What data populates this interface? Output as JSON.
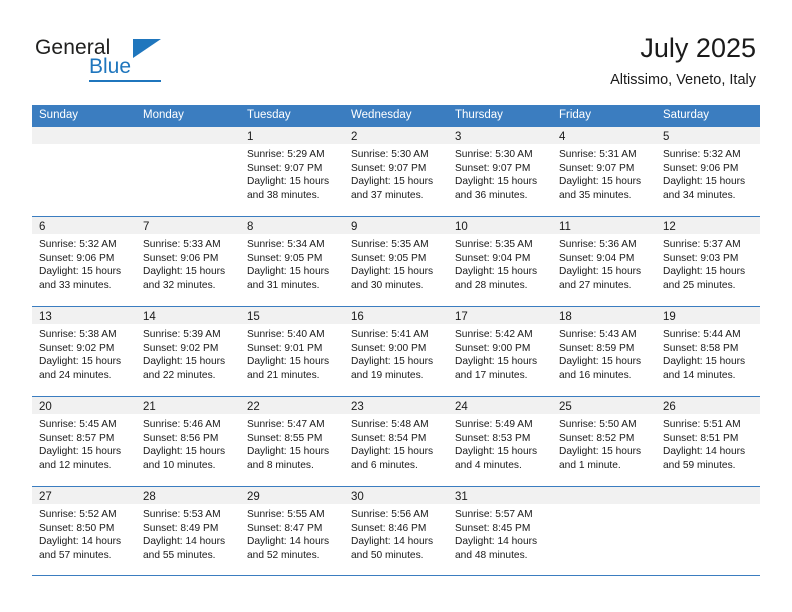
{
  "brand": {
    "name_part1": "General",
    "name_part2": "Blue",
    "accent_color": "#1f76bd"
  },
  "header": {
    "month_title": "July 2025",
    "location": "Altissimo, Veneto, Italy"
  },
  "calendar": {
    "header_color": "#3b7dc0",
    "daynum_band_color": "#f1f1f1",
    "weekdays": [
      "Sunday",
      "Monday",
      "Tuesday",
      "Wednesday",
      "Thursday",
      "Friday",
      "Saturday"
    ],
    "labels": {
      "sunrise": "Sunrise:",
      "sunset": "Sunset:",
      "daylight": "Daylight:"
    },
    "weeks": [
      [
        {
          "day": "",
          "sunrise": "",
          "sunset": "",
          "daylight": ""
        },
        {
          "day": "",
          "sunrise": "",
          "sunset": "",
          "daylight": ""
        },
        {
          "day": "1",
          "sunrise": "Sunrise: 5:29 AM",
          "sunset": "Sunset: 9:07 PM",
          "daylight": "Daylight: 15 hours and 38 minutes."
        },
        {
          "day": "2",
          "sunrise": "Sunrise: 5:30 AM",
          "sunset": "Sunset: 9:07 PM",
          "daylight": "Daylight: 15 hours and 37 minutes."
        },
        {
          "day": "3",
          "sunrise": "Sunrise: 5:30 AM",
          "sunset": "Sunset: 9:07 PM",
          "daylight": "Daylight: 15 hours and 36 minutes."
        },
        {
          "day": "4",
          "sunrise": "Sunrise: 5:31 AM",
          "sunset": "Sunset: 9:07 PM",
          "daylight": "Daylight: 15 hours and 35 minutes."
        },
        {
          "day": "5",
          "sunrise": "Sunrise: 5:32 AM",
          "sunset": "Sunset: 9:06 PM",
          "daylight": "Daylight: 15 hours and 34 minutes."
        }
      ],
      [
        {
          "day": "6",
          "sunrise": "Sunrise: 5:32 AM",
          "sunset": "Sunset: 9:06 PM",
          "daylight": "Daylight: 15 hours and 33 minutes."
        },
        {
          "day": "7",
          "sunrise": "Sunrise: 5:33 AM",
          "sunset": "Sunset: 9:06 PM",
          "daylight": "Daylight: 15 hours and 32 minutes."
        },
        {
          "day": "8",
          "sunrise": "Sunrise: 5:34 AM",
          "sunset": "Sunset: 9:05 PM",
          "daylight": "Daylight: 15 hours and 31 minutes."
        },
        {
          "day": "9",
          "sunrise": "Sunrise: 5:35 AM",
          "sunset": "Sunset: 9:05 PM",
          "daylight": "Daylight: 15 hours and 30 minutes."
        },
        {
          "day": "10",
          "sunrise": "Sunrise: 5:35 AM",
          "sunset": "Sunset: 9:04 PM",
          "daylight": "Daylight: 15 hours and 28 minutes."
        },
        {
          "day": "11",
          "sunrise": "Sunrise: 5:36 AM",
          "sunset": "Sunset: 9:04 PM",
          "daylight": "Daylight: 15 hours and 27 minutes."
        },
        {
          "day": "12",
          "sunrise": "Sunrise: 5:37 AM",
          "sunset": "Sunset: 9:03 PM",
          "daylight": "Daylight: 15 hours and 25 minutes."
        }
      ],
      [
        {
          "day": "13",
          "sunrise": "Sunrise: 5:38 AM",
          "sunset": "Sunset: 9:02 PM",
          "daylight": "Daylight: 15 hours and 24 minutes."
        },
        {
          "day": "14",
          "sunrise": "Sunrise: 5:39 AM",
          "sunset": "Sunset: 9:02 PM",
          "daylight": "Daylight: 15 hours and 22 minutes."
        },
        {
          "day": "15",
          "sunrise": "Sunrise: 5:40 AM",
          "sunset": "Sunset: 9:01 PM",
          "daylight": "Daylight: 15 hours and 21 minutes."
        },
        {
          "day": "16",
          "sunrise": "Sunrise: 5:41 AM",
          "sunset": "Sunset: 9:00 PM",
          "daylight": "Daylight: 15 hours and 19 minutes."
        },
        {
          "day": "17",
          "sunrise": "Sunrise: 5:42 AM",
          "sunset": "Sunset: 9:00 PM",
          "daylight": "Daylight: 15 hours and 17 minutes."
        },
        {
          "day": "18",
          "sunrise": "Sunrise: 5:43 AM",
          "sunset": "Sunset: 8:59 PM",
          "daylight": "Daylight: 15 hours and 16 minutes."
        },
        {
          "day": "19",
          "sunrise": "Sunrise: 5:44 AM",
          "sunset": "Sunset: 8:58 PM",
          "daylight": "Daylight: 15 hours and 14 minutes."
        }
      ],
      [
        {
          "day": "20",
          "sunrise": "Sunrise: 5:45 AM",
          "sunset": "Sunset: 8:57 PM",
          "daylight": "Daylight: 15 hours and 12 minutes."
        },
        {
          "day": "21",
          "sunrise": "Sunrise: 5:46 AM",
          "sunset": "Sunset: 8:56 PM",
          "daylight": "Daylight: 15 hours and 10 minutes."
        },
        {
          "day": "22",
          "sunrise": "Sunrise: 5:47 AM",
          "sunset": "Sunset: 8:55 PM",
          "daylight": "Daylight: 15 hours and 8 minutes."
        },
        {
          "day": "23",
          "sunrise": "Sunrise: 5:48 AM",
          "sunset": "Sunset: 8:54 PM",
          "daylight": "Daylight: 15 hours and 6 minutes."
        },
        {
          "day": "24",
          "sunrise": "Sunrise: 5:49 AM",
          "sunset": "Sunset: 8:53 PM",
          "daylight": "Daylight: 15 hours and 4 minutes."
        },
        {
          "day": "25",
          "sunrise": "Sunrise: 5:50 AM",
          "sunset": "Sunset: 8:52 PM",
          "daylight": "Daylight: 15 hours and 1 minute."
        },
        {
          "day": "26",
          "sunrise": "Sunrise: 5:51 AM",
          "sunset": "Sunset: 8:51 PM",
          "daylight": "Daylight: 14 hours and 59 minutes."
        }
      ],
      [
        {
          "day": "27",
          "sunrise": "Sunrise: 5:52 AM",
          "sunset": "Sunset: 8:50 PM",
          "daylight": "Daylight: 14 hours and 57 minutes."
        },
        {
          "day": "28",
          "sunrise": "Sunrise: 5:53 AM",
          "sunset": "Sunset: 8:49 PM",
          "daylight": "Daylight: 14 hours and 55 minutes."
        },
        {
          "day": "29",
          "sunrise": "Sunrise: 5:55 AM",
          "sunset": "Sunset: 8:47 PM",
          "daylight": "Daylight: 14 hours and 52 minutes."
        },
        {
          "day": "30",
          "sunrise": "Sunrise: 5:56 AM",
          "sunset": "Sunset: 8:46 PM",
          "daylight": "Daylight: 14 hours and 50 minutes."
        },
        {
          "day": "31",
          "sunrise": "Sunrise: 5:57 AM",
          "sunset": "Sunset: 8:45 PM",
          "daylight": "Daylight: 14 hours and 48 minutes."
        },
        {
          "day": "",
          "sunrise": "",
          "sunset": "",
          "daylight": ""
        },
        {
          "day": "",
          "sunrise": "",
          "sunset": "",
          "daylight": ""
        }
      ]
    ]
  }
}
